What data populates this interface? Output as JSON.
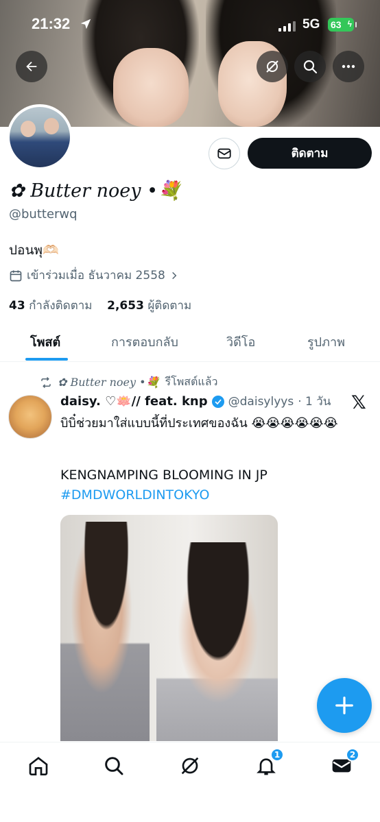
{
  "status_bar": {
    "time": "21:32",
    "network": "5G",
    "battery": "63"
  },
  "header_icons": [
    "back-arrow-icon",
    "grok-icon",
    "search-icon",
    "more-icon"
  ],
  "profile": {
    "display_name": "✿ Butter noey •💐",
    "handle": "@butterwq",
    "bio": "ปอนพุ🫶🏻",
    "joined": "เข้าร่วมเมื่อ ธันวาคม 2558",
    "following_count": "43",
    "following_label": "กำลังติดตาม",
    "followers_count": "2,653",
    "followers_label": "ผู้ติดตาม",
    "follow_button": "ติดตาม"
  },
  "tabs": [
    {
      "label": "โพสต์",
      "active": true
    },
    {
      "label": "การตอบกลับ",
      "active": false
    },
    {
      "label": "วิดีโอ",
      "active": false
    },
    {
      "label": "รูปภาพ",
      "active": false
    }
  ],
  "post": {
    "repost_by": "✿ Butter noey •💐",
    "repost_suffix": "รีโพสต์แล้ว",
    "author_name": "daisy. ♡🪷// feat. knp",
    "author_handle": "@daisylyys",
    "time": "· 1 วัน",
    "text": "บิบิ๋ช่วยมาใส่แบบนี้ที่ประเทศของฉัน 😭😭😭😭😭😭",
    "line2": "KENGNAMPING BLOOMING IN JP",
    "hashtag": "#DMDWORLDINTOKYO"
  },
  "nav": {
    "notifications_badge": "1",
    "messages_badge": "2"
  },
  "colors": {
    "accent": "#1d9bf0",
    "text_primary": "#0f1419",
    "text_secondary": "#536471",
    "battery": "#34c759"
  }
}
